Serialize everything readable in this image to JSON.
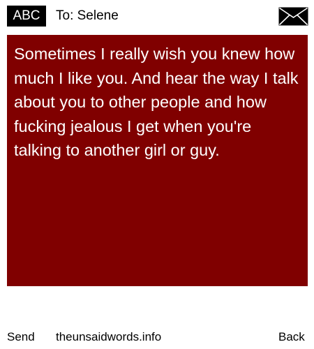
{
  "header": {
    "input_mode": "ABC",
    "recipient": "To: Selene",
    "icon": "envelope-icon"
  },
  "message": {
    "text": "Sometimes I really wish you knew how much I like you. And hear the way I talk about you to other people and how fucking jealous I get when you're talking to another girl or guy."
  },
  "footer": {
    "send_label": "Send",
    "site_label": "theunsaidwords.info",
    "back_label": "Back"
  },
  "colors": {
    "message_background": "#800000",
    "message_text": "#ffffff",
    "badge_background": "#000000"
  }
}
